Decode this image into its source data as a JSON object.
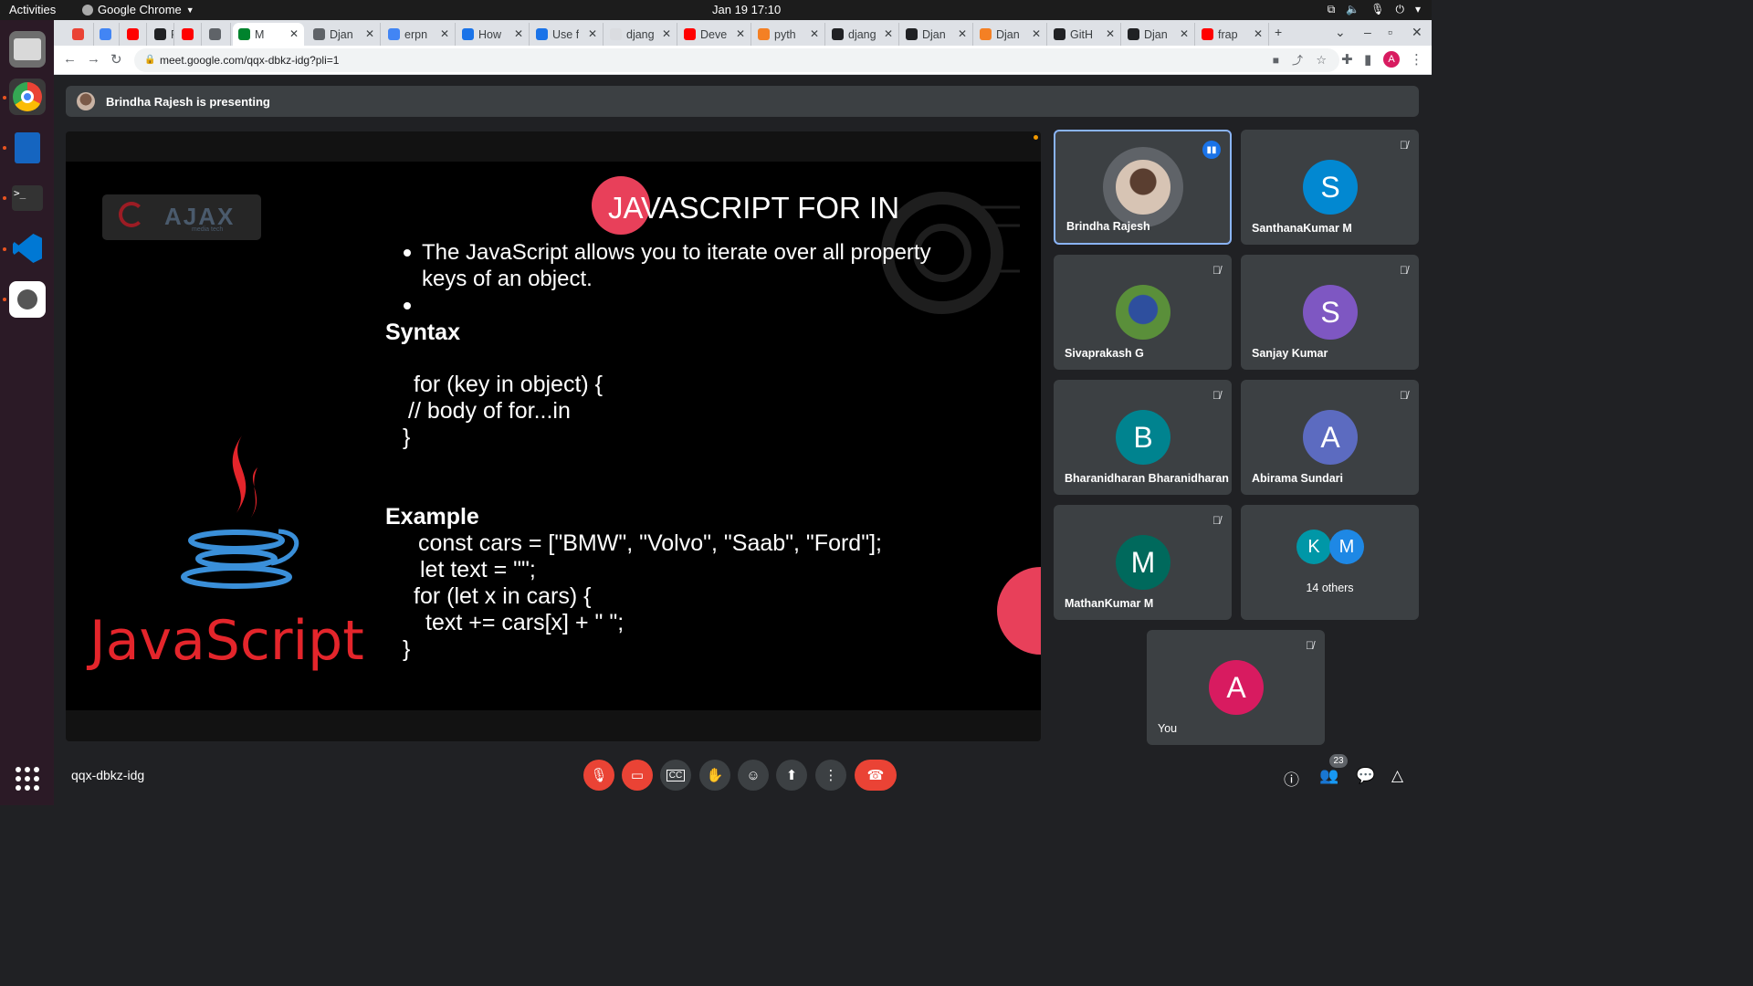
{
  "topbar": {
    "activities": "Activities",
    "app": "Google Chrome",
    "clock": "Jan 19  17:10"
  },
  "tabs": [
    {
      "label": "",
      "color": "#ea4335"
    },
    {
      "label": "",
      "color": "#4285f4"
    },
    {
      "label": "",
      "color": "#ff0000"
    },
    {
      "label": "F",
      "color": "#202124"
    },
    {
      "label": "",
      "color": "#ff0000"
    },
    {
      "label": "",
      "color": "#5f6368"
    },
    {
      "label": "M",
      "color": "#00832d"
    },
    {
      "label": "Djan",
      "color": "#5f6368"
    },
    {
      "label": "erpn",
      "color": "#4285f4"
    },
    {
      "label": "How",
      "color": "#1a73e8"
    },
    {
      "label": "Use f",
      "color": "#1a73e8"
    },
    {
      "label": "djang",
      "color": "#dadce0"
    },
    {
      "label": "Deve",
      "color": "#ff0000"
    },
    {
      "label": "pyth",
      "color": "#f48024"
    },
    {
      "label": "djang",
      "color": "#202124"
    },
    {
      "label": "Djan",
      "color": "#202124"
    },
    {
      "label": "Djan",
      "color": "#f48024"
    },
    {
      "label": "GitH",
      "color": "#202124"
    },
    {
      "label": "Djan",
      "color": "#202124"
    },
    {
      "label": "frap",
      "color": "#ff0000"
    }
  ],
  "address": {
    "url": "meet.google.com/qqx-dbkz-idg?pli=1"
  },
  "profile_initial": "A",
  "banner": {
    "text": "Brindha Rajesh is presenting"
  },
  "slide": {
    "logo": "AJAX",
    "logo_sub": "media tech",
    "title": "JAVASCRIPT FOR IN",
    "bullet1_line1": "The JavaScript allows you to iterate over all property",
    "bullet1_line2": "keys of an object.",
    "syntax_heading": "Syntax",
    "syntax_lines": [
      "for (key in object) {",
      "// body of for...in",
      "}"
    ],
    "example_heading": "Example",
    "example_lines": [
      "const cars = [\"BMW\", \"Volvo\", \"Saab\", \"Ford\"];",
      "let text = \"\";",
      "for (let x in cars) {",
      "text += cars[x] + \" \";",
      "}"
    ],
    "js_word": "JavaScript"
  },
  "participants": [
    {
      "name": "Brindha Rajesh",
      "initial": "",
      "color": "#5f6368",
      "photo": true
    },
    {
      "name": "SanthanaKumar M",
      "initial": "S",
      "color": "#0288d1"
    },
    {
      "name": "Sivaprakash G",
      "initial": "",
      "color": "#2e7d32",
      "photo": true
    },
    {
      "name": "Sanjay Kumar",
      "initial": "S",
      "color": "#7e57c2"
    },
    {
      "name": "Bharanidharan Bharanidharan",
      "initial": "B",
      "color": "#00838f"
    },
    {
      "name": "Abirama Sundari",
      "initial": "A",
      "color": "#5c6bc0"
    },
    {
      "name": "MathanKumar M",
      "initial": "M",
      "color": "#00695c"
    }
  ],
  "others": {
    "label": "14 others",
    "initials": [
      "K",
      "M"
    ],
    "colors": [
      "#0097a7",
      "#1e88e5"
    ]
  },
  "you": {
    "name": "You",
    "initial": "A",
    "color": "#d81b60"
  },
  "meeting_code": "qqx-dbkz-idg",
  "people_count": "23"
}
